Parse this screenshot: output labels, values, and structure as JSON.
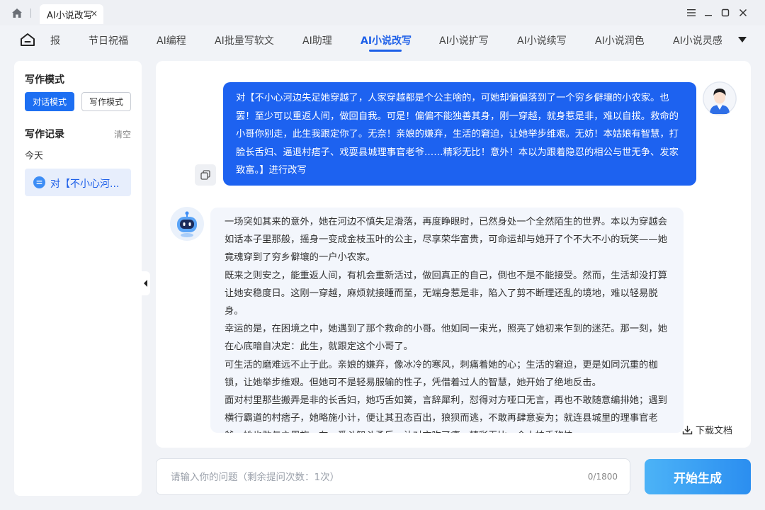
{
  "window": {
    "tab_title": "AI小说改写",
    "tab_close": "×"
  },
  "nav": {
    "items": [
      "报",
      "节日祝福",
      "AI编程",
      "AI批量写软文",
      "AI助理",
      "AI小说改写",
      "AI小说扩写",
      "AI小说续写",
      "AI小说润色",
      "AI小说灵感"
    ],
    "active_index": 5
  },
  "sidebar": {
    "mode_title": "写作模式",
    "mode_chat": "对话模式",
    "mode_write": "写作模式",
    "record_title": "写作记录",
    "clear_label": "清空",
    "today_label": "今天",
    "record_item": "对【不小心河..."
  },
  "chat": {
    "user_message": "对【不小心河边失足她穿越了，人家穿越都是个公主啥的，可她却偏偏落到了一个穷乡僻壤的小农家。也罢！至少可以重返人间，做回自我。可是！偏偏不能独善其身，刚一穿越，就身惹是非，难以自拔。救命的小哥你别走，此生我跟定你了。无奈！亲娘的嫌弃，生活的窘迫，让她举步维艰。无妨！本姑娘有智慧，打脸长舌妇、逼退村痞子、戏耍县城理事官老爷……精彩无比！意外！本以为跟着隐忍的相公与世无争、发家致富。】进行改写",
    "bot_paragraphs": [
      "一场突如其来的意外，她在河边不慎失足滑落，再度睁眼时，已然身处一个全然陌生的世界。本以为穿越会如话本子里那般，摇身一变成金枝玉叶的公主，尽享荣华富贵，可命运却与她开了个不大不小的玩笑——她竟魂穿到了穷乡僻壤的一户小农家。",
      "既来之则安之，能重返人间，有机会重新活过，做回真正的自己，倒也不是不能接受。然而，生活却没打算让她安稳度日。这刚一穿越，麻烦就接踵而至，无端身惹是非，陷入了剪不断理还乱的境地，难以轻易脱身。",
      "幸运的是，在困境之中，她遇到了那个救命的小哥。他如同一束光，照亮了她初来乍到的迷茫。那一刻，她在心底暗自决定：此生，就跟定这个小哥了。",
      "可生活的磨难远不止于此。亲娘的嫌弃，像冰冷的寒风，刺痛着她的心；生活的窘迫，更是如同沉重的枷锁，让她举步维艰。但她可不是轻易服输的性子，凭借着过人的智慧，她开始了绝地反击。",
      "面对村里那些搬弄是非的长舌妇，她巧舌如簧，言辞犀利，怼得对方哑口无言，再也不敢随意编排她；遇到横行霸道的村痞子，她略施小计，便让其丑态百出，狼狈而逃，不敢再肆意妄为；就连县城里的理事官老爷，她也敢与之周旋，在一番斗智斗勇后，让对方吃了瘪，精彩无比，令人拍手称快。"
    ],
    "download_label": "下载文档"
  },
  "input": {
    "placeholder": "请输入你的问题（剩余提问次数：1次）",
    "value": "",
    "char_count": "0/1800"
  },
  "generate_label": "开始生成",
  "colors": {
    "accent": "#1d62f0",
    "active_nav": "#1d5fe8",
    "generate_gradient_start": "#4cb3f7",
    "generate_gradient_end": "#2b8ef0"
  }
}
